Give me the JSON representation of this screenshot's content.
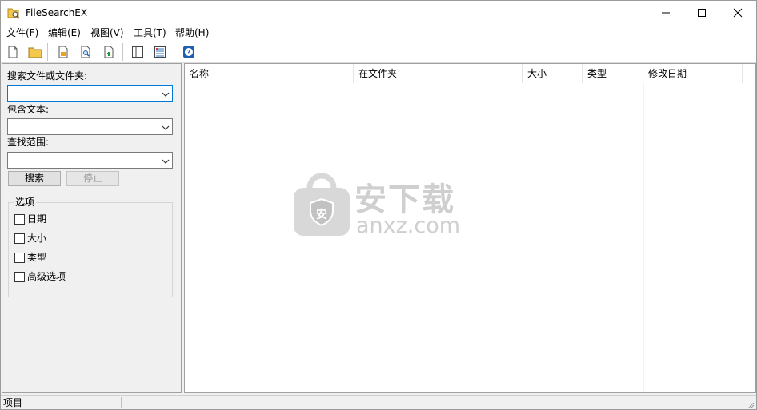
{
  "window": {
    "title": "FileSearchEX"
  },
  "menu": [
    "文件(F)",
    "编辑(E)",
    "视图(V)",
    "工具(T)",
    "帮助(H)"
  ],
  "toolbar": {
    "buttons": [
      "new-file-icon",
      "open-folder-icon",
      "save-results-icon",
      "find-in-file-icon",
      "export-icon",
      "panel-view-icon",
      "details-view-icon",
      "help-icon"
    ]
  },
  "search_panel": {
    "name_label": "搜索文件或文件夹:",
    "name_value": "",
    "text_label": "包含文本:",
    "text_value": "",
    "scope_label": "查找范围:",
    "scope_value": "",
    "search_button": "搜索",
    "stop_button": "停止"
  },
  "options": {
    "title": "选项",
    "items": [
      {
        "label": "日期",
        "checked": false
      },
      {
        "label": "大小",
        "checked": false
      },
      {
        "label": "类型",
        "checked": false
      },
      {
        "label": "高级选项",
        "checked": false
      }
    ]
  },
  "results": {
    "columns": [
      "名称",
      "在文件夹",
      "大小",
      "类型",
      "修改日期"
    ],
    "rows": []
  },
  "watermark": {
    "cn": "安下载",
    "en": "anxz.com"
  },
  "statusbar": {
    "text": "项目"
  }
}
